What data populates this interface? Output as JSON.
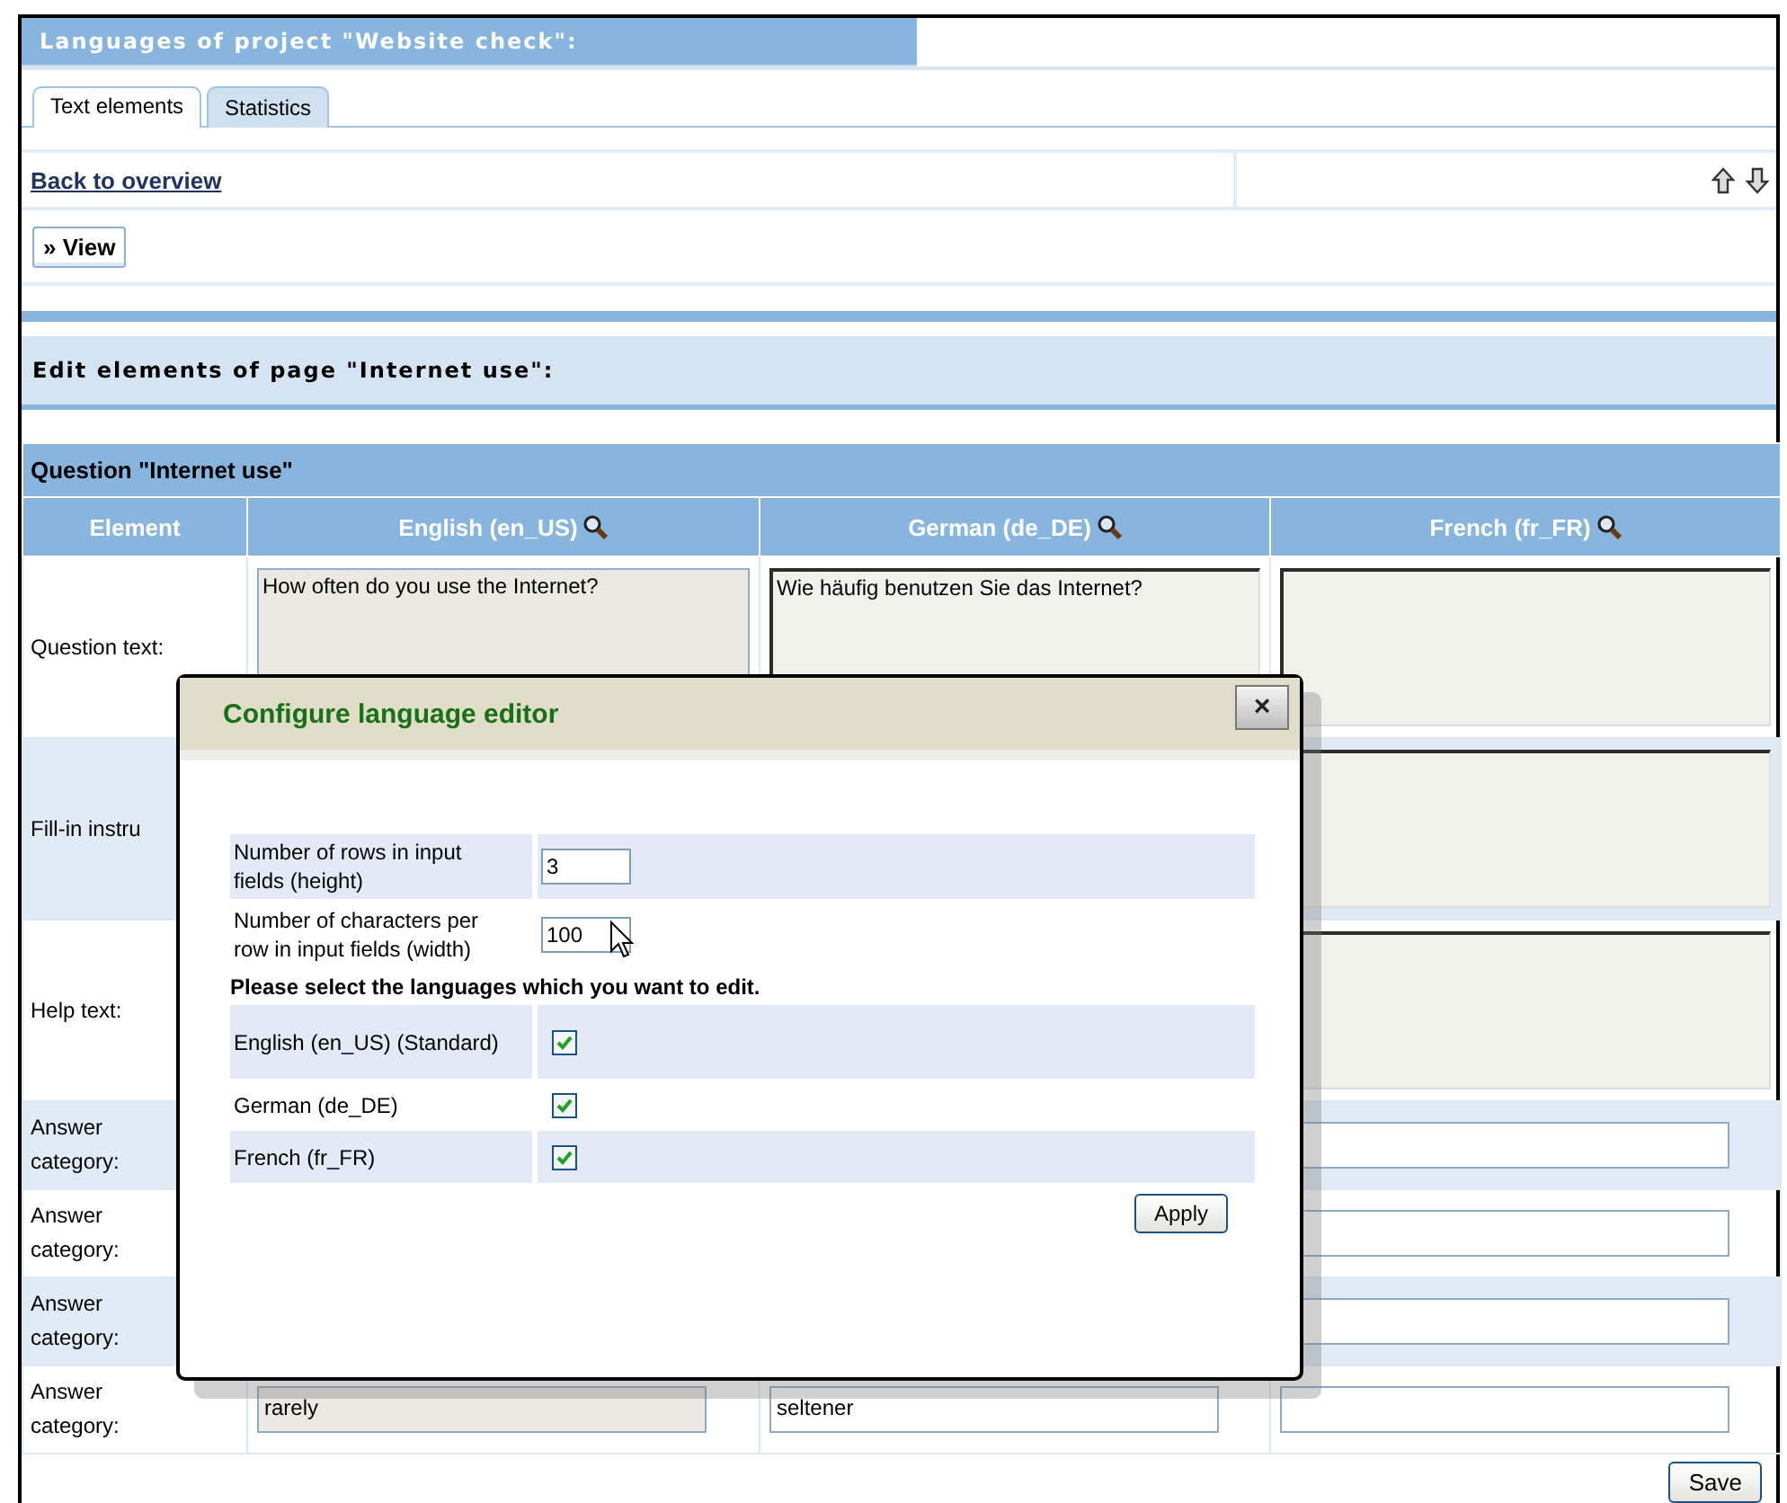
{
  "header": {
    "title": "Languages of project \"Website check\":"
  },
  "tabs": [
    {
      "label": "Text elements",
      "selected": true
    },
    {
      "label": "Statistics",
      "selected": false
    }
  ],
  "back_link": "Back to overview",
  "view_button": "» View",
  "section_title": "Edit elements of page \"Internet use\":",
  "question": {
    "title": "Question \"Internet use\"",
    "columns": [
      {
        "label": "Element",
        "search": false
      },
      {
        "label": "English (en_US)",
        "search": true
      },
      {
        "label": "German (de_DE)",
        "search": true
      },
      {
        "label": "French (fr_FR)",
        "search": true
      }
    ],
    "rows": [
      {
        "kind": "textarea",
        "cells": [
          "Question text:",
          "How often do you use the Internet?",
          "Wie häufig benutzen Sie das Internet?",
          ""
        ]
      },
      {
        "kind": "textarea",
        "cells": [
          "Fill-in instru",
          null,
          null,
          ""
        ]
      },
      {
        "kind": "textarea",
        "cells": [
          "Help text:",
          null,
          null,
          ""
        ]
      },
      {
        "kind": "input",
        "cells": [
          "Answer category:",
          null,
          null,
          ""
        ]
      },
      {
        "kind": "input",
        "cells": [
          "Answer category:",
          null,
          null,
          ""
        ]
      },
      {
        "kind": "input",
        "cells": [
          "Answer category:",
          null,
          null,
          ""
        ]
      },
      {
        "kind": "input",
        "cells": [
          "Answer category:",
          "rarely",
          "seltener",
          ""
        ]
      }
    ]
  },
  "save_button": "Save",
  "dialog": {
    "title": "Configure language editor",
    "close": "×",
    "settings": [
      {
        "label": "Number of rows in input fields (height)",
        "value": "3"
      },
      {
        "label": "Number of characters per row in input fields (width)",
        "value": "100"
      }
    ],
    "prompt": "Please select the languages which you want to edit.",
    "languages": [
      {
        "label": "English (en_US) (Standard)",
        "checked": true
      },
      {
        "label": "German (de_DE)",
        "checked": true
      },
      {
        "label": "French (fr_FR)",
        "checked": true
      }
    ],
    "apply_button": "Apply"
  }
}
